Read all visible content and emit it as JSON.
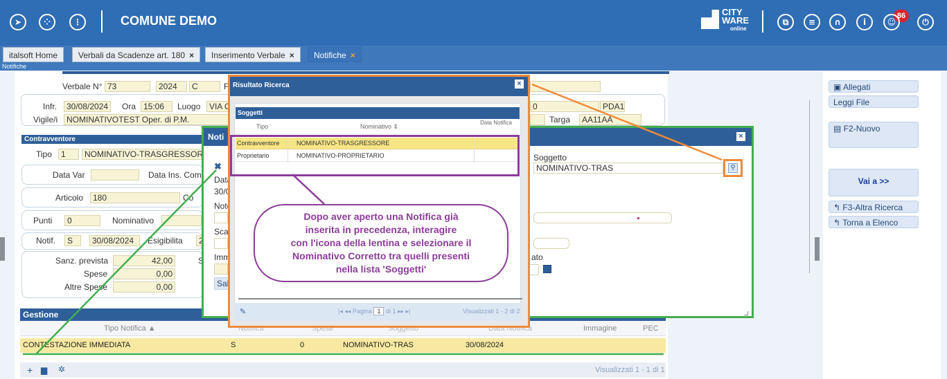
{
  "app": {
    "title": "COMUNE DEMO",
    "brand_line1": "CITY",
    "brand_line2": "WARE",
    "brand_line3": "online",
    "notification_count": "86",
    "accent": "#2f6db5"
  },
  "tabs": [
    {
      "label": "italsoft Home"
    },
    {
      "label": "Verbali da Scadenze art. 180",
      "close": "×"
    },
    {
      "label": "Inserimento Verbale",
      "close": "×"
    },
    {
      "label": "Notifiche",
      "close": "×"
    }
  ],
  "breadcrumb": "Notifiche",
  "verbale": {
    "label": "Verbale N°",
    "numero": "73",
    "anno": "2024",
    "serie": "C",
    "trunc": "F",
    "infr_label": "Infr.",
    "infr_data": "30/08/2024",
    "ora_label": "Ora",
    "ora": "15:06",
    "luogo_label": "Luogo",
    "luogo": "VIA C",
    "vigile_label": "Vigile/i",
    "vigile": "NOMINATIVOTEST  Oper. di P.M.",
    "right_val": "0",
    "pda": "PDA1",
    "targa_label": "Targa",
    "targa": "AA11AA"
  },
  "contravventore": {
    "header": "Contravventore",
    "tipo_label": "Tipo",
    "tipo": "1",
    "tipo_desc": "NOMINATIVO-TRASGRESSORE",
    "datavar_label": "Data Var",
    "datains_label": "Data Ins. Com.",
    "articolo_label": "Articolo",
    "articolo": "180",
    "art_trunc": "Co",
    "punti_label": "Punti",
    "punti": "0",
    "nominativo_label": "Nominativo",
    "notif_label": "Notif.",
    "notif": "S",
    "notif_data": "30/08/2024",
    "esig_label": "Esigibilita",
    "esig": "2",
    "sanz_label": "Sanz. prevista",
    "sanz": "42,00",
    "spese_label": "Spese",
    "spese": "0,00",
    "altre_label": "Altre Spese",
    "altre": "0,00",
    "s_trunc": "S"
  },
  "gestione": {
    "header": "Gestione",
    "columns": [
      "Tipo Notifica",
      "Notifica",
      "Spese",
      "Soggetto",
      "Data Notifica",
      "Immagine",
      "PEC"
    ],
    "sort_icon": "sort-asc-icon",
    "row": {
      "tipo": "CONTESTAZIONE IMMEDIATA",
      "notifica": "S",
      "spese": "0",
      "soggetto": "NOMINATIVO-TRAS",
      "data": "30/08/2024"
    },
    "footer": "Visualizzati 1 - 1 di 1"
  },
  "sidebar": {
    "allegati": "Allegati",
    "leggi_file": "Leggi File",
    "nuovo": "F2-Nuovo",
    "vai_a": "Vai a >>",
    "altra_ricerca": "F3-Altra Ricerca",
    "torna": "Torna a Elenco"
  },
  "notif_dialog": {
    "title": "Noti",
    "soggetto_label": "Soggetto",
    "soggetto": "NOMINATIVO-TRAS",
    "data_label": "Data",
    "data_val": "30/0",
    "note_label": "Note",
    "scat_label": "Scat",
    "imm_label": "Imm",
    "save_label": "Sal",
    "ato_label": "ato",
    "close": "×"
  },
  "result_dialog": {
    "title": "Risultato Ricerca",
    "close": "×",
    "section": "Soggetti",
    "columns": [
      "Tipo",
      "Nominativo",
      "Data Notifica"
    ],
    "rows": [
      {
        "tipo": "Contravventore",
        "nominativo": "NOMINATIVO-TRASGRESSORE",
        "data": ""
      },
      {
        "tipo": "Proprietario",
        "nominativo": "NOMINATIVO-PROPRIETARIO",
        "data": ""
      }
    ],
    "pager_label": "Pagina",
    "page": "1",
    "of": "di 1",
    "status": "Visualizzati 1 - 2 di 2"
  },
  "callout": {
    "lines": [
      "Dopo aver aperto una Notifica già",
      "inserita in precedenza, interagire",
      "con l'icona della lentina e selezionare il",
      "Nominativo Corretto tra quelli presenti",
      "nella lista 'Soggetti'"
    ]
  }
}
